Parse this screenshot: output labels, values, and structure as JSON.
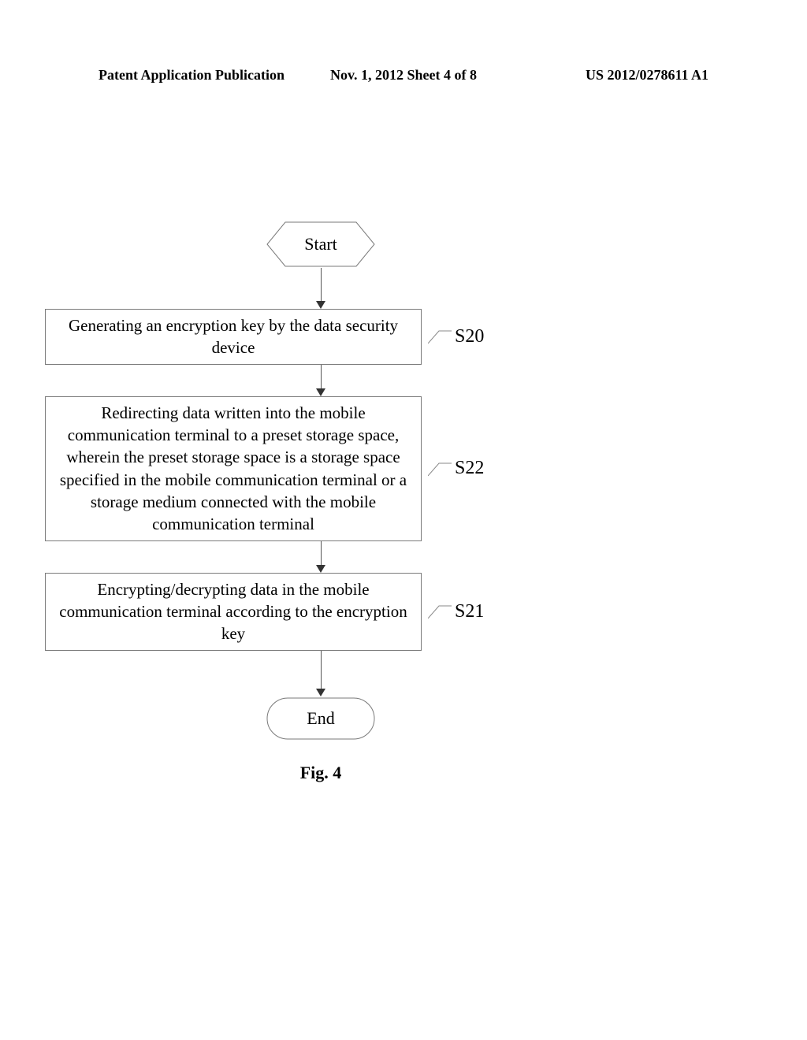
{
  "header": {
    "left": "Patent Application Publication",
    "center": "Nov. 1, 2012   Sheet 4 of 8",
    "right": "US 2012/0278611 A1"
  },
  "flow": {
    "start": "Start",
    "end": "End",
    "caption": "Fig. 4",
    "steps": [
      {
        "label": "S20",
        "text": "Generating an encryption key by the data security device"
      },
      {
        "label": "S22",
        "text": "Redirecting data written into the mobile communication terminal to a preset storage space, wherein the preset storage space is a storage space specified in the mobile communication terminal or a storage medium connected with the mobile communication terminal"
      },
      {
        "label": "S21",
        "text": "Encrypting/decrypting data in the mobile communication terminal according to the encryption key"
      }
    ]
  }
}
